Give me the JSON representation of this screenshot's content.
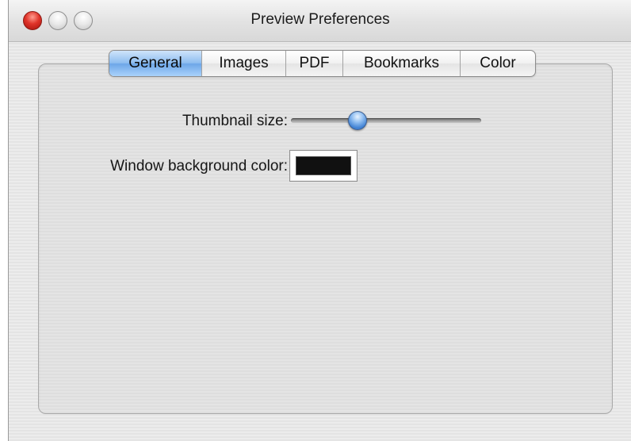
{
  "window": {
    "title": "Preview Preferences"
  },
  "tabs": [
    {
      "label": "General",
      "selected": true
    },
    {
      "label": "Images",
      "selected": false
    },
    {
      "label": "PDF",
      "selected": false
    },
    {
      "label": "Bookmarks",
      "selected": false
    },
    {
      "label": "Color",
      "selected": false
    }
  ],
  "general": {
    "thumbnail_size_label": "Thumbnail size:",
    "thumbnail_size_value": 0.35,
    "background_color_label": "Window background color:",
    "background_color_value": "#111111"
  },
  "colors": {
    "accent": "#6ea7e8",
    "close_button": "#e0342a"
  }
}
